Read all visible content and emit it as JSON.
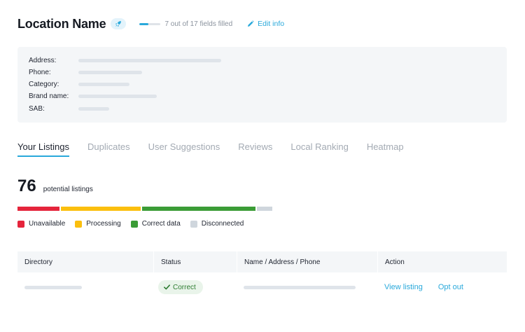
{
  "header": {
    "title": "Location Name",
    "progress_text": "7 out of 17 fields filled",
    "progress_fraction": 0.41,
    "edit_label": "Edit info"
  },
  "info": {
    "fields": [
      {
        "label": "Address:"
      },
      {
        "label": "Phone:"
      },
      {
        "label": "Category:"
      },
      {
        "label": "Brand name:"
      },
      {
        "label": "SAB:"
      }
    ]
  },
  "tabs": [
    {
      "label": "Your Listings",
      "active": true
    },
    {
      "label": "Duplicates"
    },
    {
      "label": "User Suggestions"
    },
    {
      "label": "Reviews"
    },
    {
      "label": "Local Ranking"
    },
    {
      "label": "Heatmap"
    }
  ],
  "summary": {
    "count": "76",
    "count_label": "potential listings"
  },
  "distribution": [
    {
      "name": "Unavailable",
      "color": "#e5253c",
      "share": 0.17
    },
    {
      "name": "Processing",
      "color": "#fbbf0e",
      "share": 0.32
    },
    {
      "name": "Correct data",
      "color": "#3b9c36",
      "share": 0.45
    },
    {
      "name": "Disconnected",
      "color": "#cfd6dd",
      "share": 0.06
    }
  ],
  "table": {
    "columns": [
      "Directory",
      "Status",
      "Name / Address / Phone",
      "Action"
    ],
    "row": {
      "status": "Correct",
      "view_label": "View listing",
      "optout_label": "Opt out"
    }
  },
  "colors": {
    "accent": "#2aa9db",
    "success": "#2e7d32"
  }
}
